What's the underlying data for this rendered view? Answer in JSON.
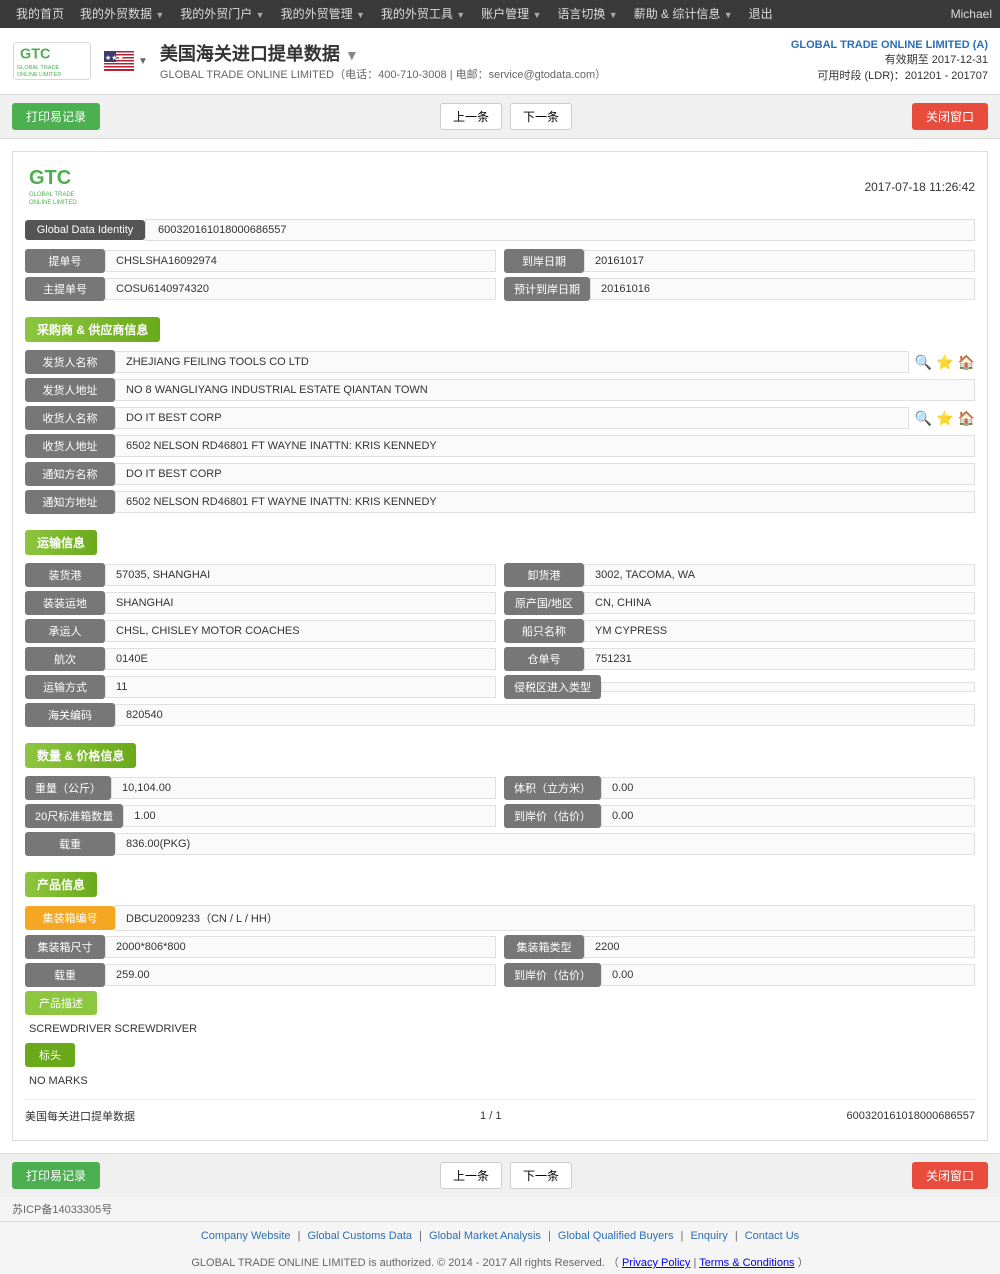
{
  "nav": {
    "items": [
      "我的首页",
      "我的外贸数据",
      "我的外贸门户",
      "我的外贸管理",
      "我的外贸工具",
      "账户管理",
      "语言切换",
      "薪助 & 综计信息",
      "退出"
    ],
    "user": "Michael"
  },
  "header": {
    "title": "美国海关进口提单数据",
    "company_name": "GLOBAL TRADE ONLINE LIMITED",
    "phone": "400-710-3008",
    "email": "service@gtodata.com",
    "account_company": "GLOBAL TRADE ONLINE LIMITED (A)",
    "expire_label": "有效期至",
    "expire_date": "2017-12-31",
    "ldr_label": "可用时段 (LDR)：201201 - 201707"
  },
  "toolbar": {
    "print_label": "打印易记录",
    "prev_label": "上一条",
    "next_label": "下一条",
    "close_label": "关闭窗口"
  },
  "record": {
    "datetime": "2017-07-18  11:26:42",
    "gdi_label": "Global Data Identity",
    "gdi_value": "600320161018000686557",
    "bill_no_label": "提单号",
    "bill_no_value": "CHSLSHA16092974",
    "arrival_date_label": "到岸日期",
    "arrival_date_value": "20161017",
    "master_bill_label": "主提单号",
    "master_bill_value": "COSU6140974320",
    "estimated_arrival_label": "预计到岸日期",
    "estimated_arrival_value": "20161016"
  },
  "buyer_supplier": {
    "section_title": "采购商 & 供应商信息",
    "shipper_name_label": "发货人名称",
    "shipper_name_value": "ZHEJIANG FEILING TOOLS CO LTD",
    "shipper_addr_label": "发货人地址",
    "shipper_addr_value": "NO 8 WANGLIYANG INDUSTRIAL ESTATE QIANTAN TOWN",
    "consignee_name_label": "收货人名称",
    "consignee_name_value": "DO IT BEST CORP",
    "consignee_addr_label": "收货人地址",
    "consignee_addr_value": "6502 NELSON RD46801 FT WAYNE INATTN: KRIS KENNEDY",
    "notify_name_label": "通知方名称",
    "notify_name_value": "DO IT BEST CORP",
    "notify_addr_label": "通知方地址",
    "notify_addr_value": "6502 NELSON RD46801 FT WAYNE INATTN: KRIS KENNEDY"
  },
  "transport": {
    "section_title": "运输信息",
    "loading_port_label": "装货港",
    "loading_port_value": "57035, SHANGHAI",
    "discharge_port_label": "卸货港",
    "discharge_port_value": "3002, TACOMA, WA",
    "loading_place_label": "装装运地",
    "loading_place_value": "SHANGHAI",
    "origin_country_label": "原产国/地区",
    "origin_country_value": "CN, CHINA",
    "carrier_label": "承运人",
    "carrier_value": "CHSL, CHISLEY MOTOR COACHES",
    "vessel_label": "船只名称",
    "vessel_value": "YM CYPRESS",
    "voyage_label": "航次",
    "voyage_value": "0140E",
    "warehouse_label": "仓单号",
    "warehouse_value": "751231",
    "transport_mode_label": "运输方式",
    "transport_mode_value": "11",
    "bonded_label": "侵税区进入类型",
    "bonded_value": "",
    "customs_code_label": "海关编码",
    "customs_code_value": "820540"
  },
  "quantity": {
    "section_title": "数量 & 价格信息",
    "weight_label": "重量（公斤）",
    "weight_value": "10,104.00",
    "volume_label": "体积（立方米）",
    "volume_value": "0.00",
    "container20_label": "20尺标准箱数量",
    "container20_value": "1.00",
    "arrival_price_label": "到岸价（估价）",
    "arrival_price_value": "0.00",
    "quantity_label": "载重",
    "quantity_value": "836.00(PKG)"
  },
  "product": {
    "section_title": "产品信息",
    "container_no_label": "集装箱编号",
    "container_no_value": "DBCU2009233（CN / L / HH）",
    "container_size_label": "集装箱尺寸",
    "container_size_value": "2000*806*800",
    "container_type_label": "集装箱类型",
    "container_type_value": "2200",
    "quantity_label": "载重",
    "quantity_value": "259.00",
    "arrival_price_label": "到岸价（估价）",
    "arrival_price_value": "0.00",
    "description_label": "产品描述",
    "description_value": "SCREWDRIVER SCREWDRIVER",
    "marks_label": "标头",
    "marks_value": "NO MARKS"
  },
  "record_footer": {
    "title": "美国每关进口提单数据",
    "pagination": "1 / 1",
    "gdi": "600320161018000686557"
  },
  "bottom_toolbar": {
    "print_label": "打印易记录",
    "prev_label": "上一条",
    "next_label": "下一条",
    "close_label": "关闭窗口"
  },
  "footer": {
    "icp": "苏ICP备14033305号",
    "links": [
      "Company Website",
      "Global Customs Data",
      "Global Market Analysis",
      "Global Qualified Buyers",
      "Enquiry",
      "Contact Us"
    ],
    "copyright": "GLOBAL TRADE ONLINE LIMITED is authorized. © 2014 - 2017 All rights Reserved.",
    "privacy_label": "Privacy Policy",
    "terms_label": "Terms & Conditions"
  }
}
